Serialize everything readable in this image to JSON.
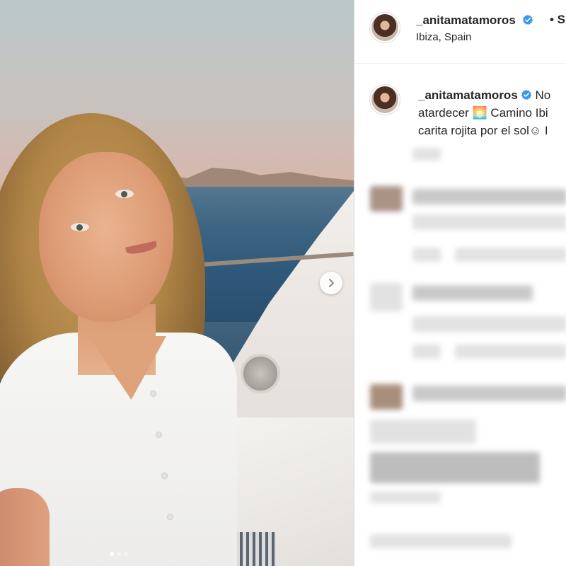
{
  "post": {
    "username": "_anitamatamoros",
    "location": "Ibiza, Spain",
    "follow_separator": "• S",
    "caption": {
      "line1": "No",
      "line2": "atardecer 🌅 Camino Ibi",
      "line3": "carita rojita por el sol☺ I"
    },
    "carousel": {
      "total_slides": 3,
      "active_slide": 1
    }
  },
  "colors": {
    "verified": "#3897f0",
    "text": "#262626",
    "border": "#dbdbdb"
  },
  "icons": {
    "verified": "verified-badge-icon",
    "next": "chevron-right-icon"
  }
}
